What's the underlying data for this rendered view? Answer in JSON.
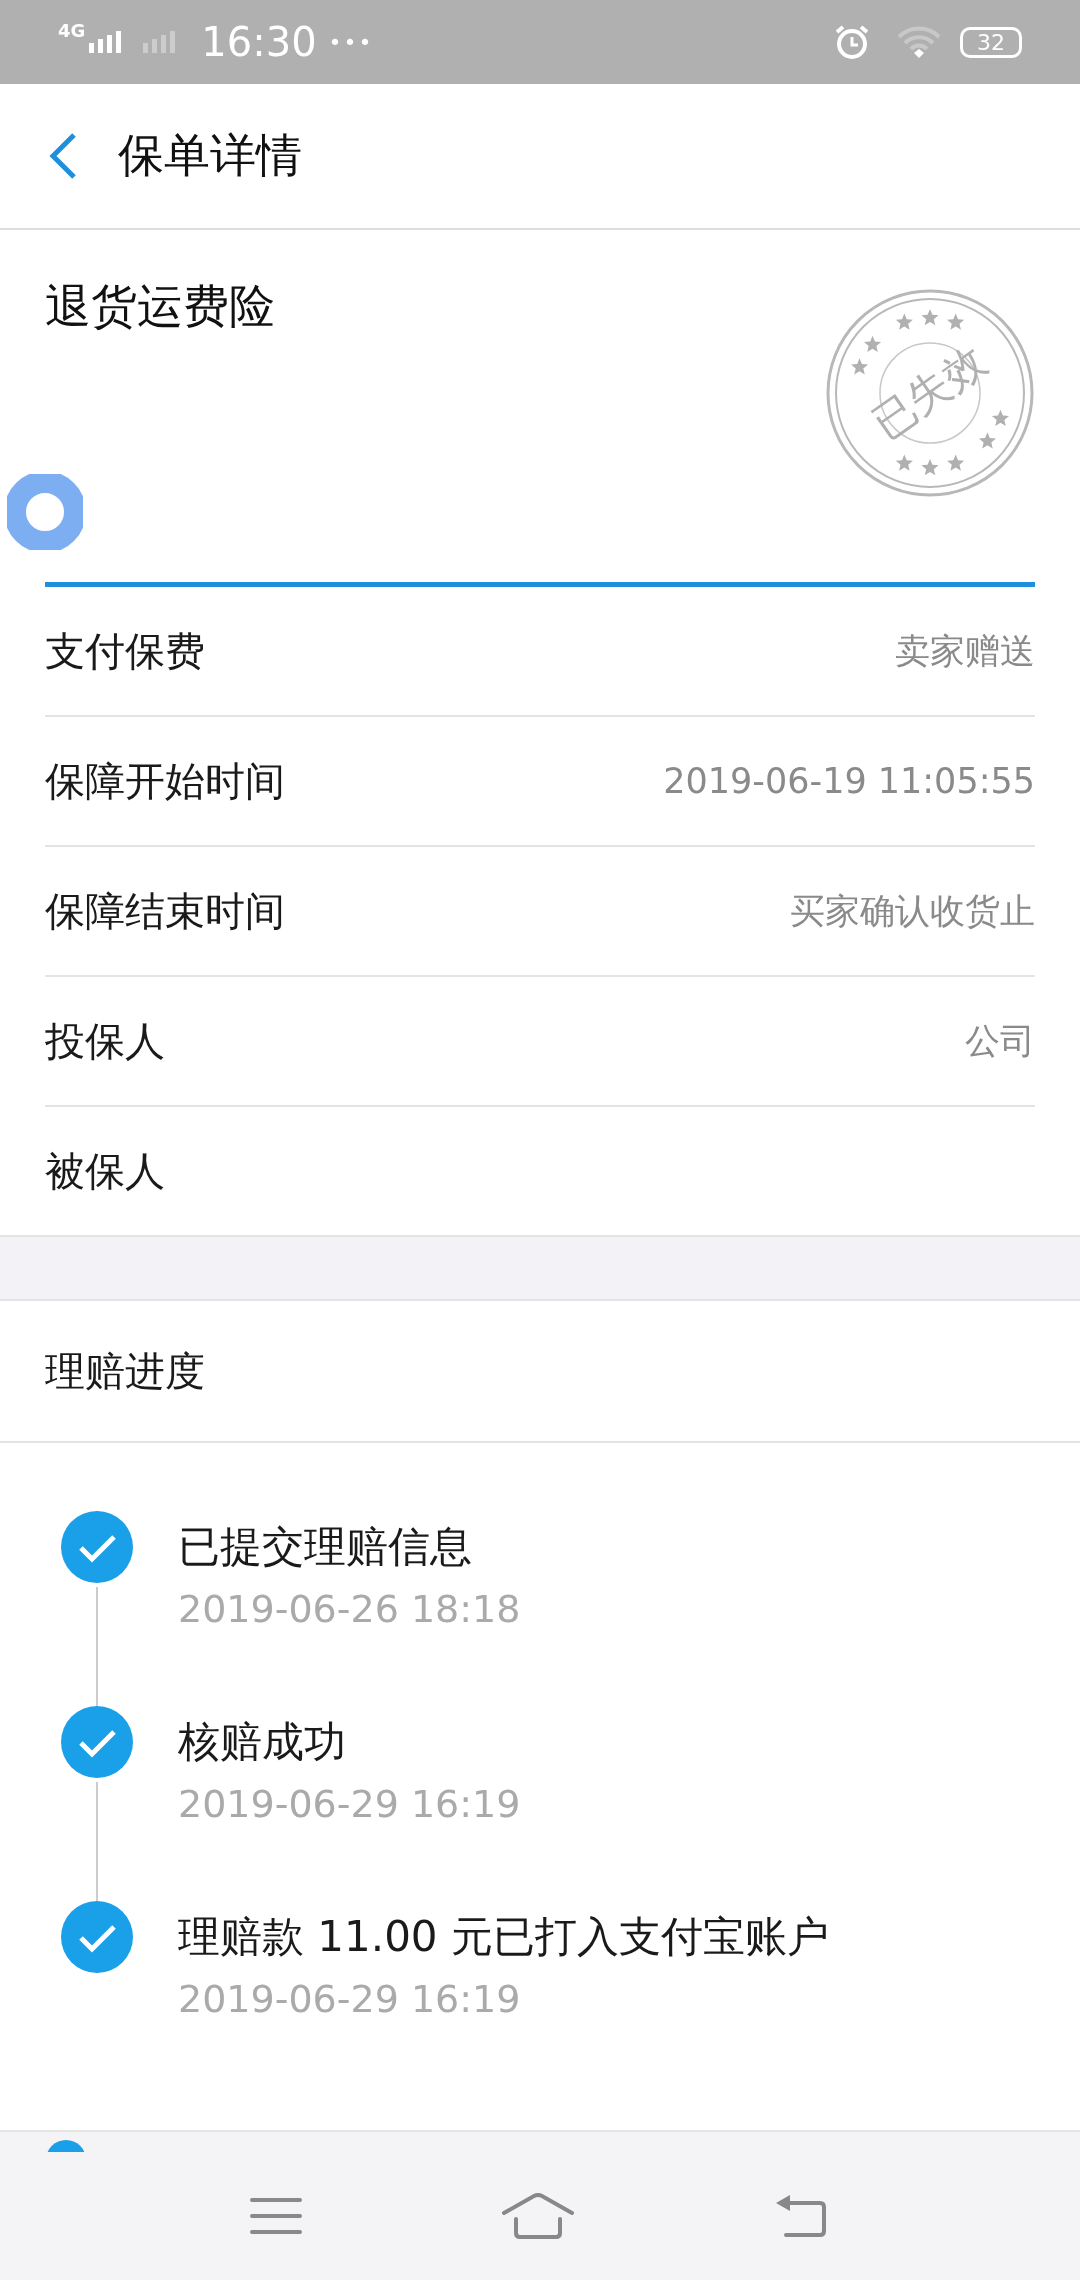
{
  "status_bar": {
    "network": "4G",
    "time": "16:30",
    "more": "•••",
    "battery": "32"
  },
  "header": {
    "title": "保单详情"
  },
  "policy": {
    "name": "退货运费险",
    "stamp": "已失效"
  },
  "details": [
    {
      "label": "支付保费",
      "value": "卖家赠送"
    },
    {
      "label": "保障开始时间",
      "value": "2019-06-19 11:05:55"
    },
    {
      "label": "保障结束时间",
      "value": "买家确认收货止"
    },
    {
      "label": "投保人",
      "value": "公司"
    },
    {
      "label": "被保人"
    }
  ],
  "claim": {
    "title": "理赔进度",
    "steps": [
      {
        "title": "已提交理赔信息",
        "time": "2019-06-26 18:18",
        "done": true
      },
      {
        "title": "核赔成功",
        "time": "2019-06-29 16:19",
        "done": true
      },
      {
        "title": "理赔款 11.00 元已打入支付宝账户",
        "time": "2019-06-29 16:19",
        "done": true
      }
    ]
  }
}
